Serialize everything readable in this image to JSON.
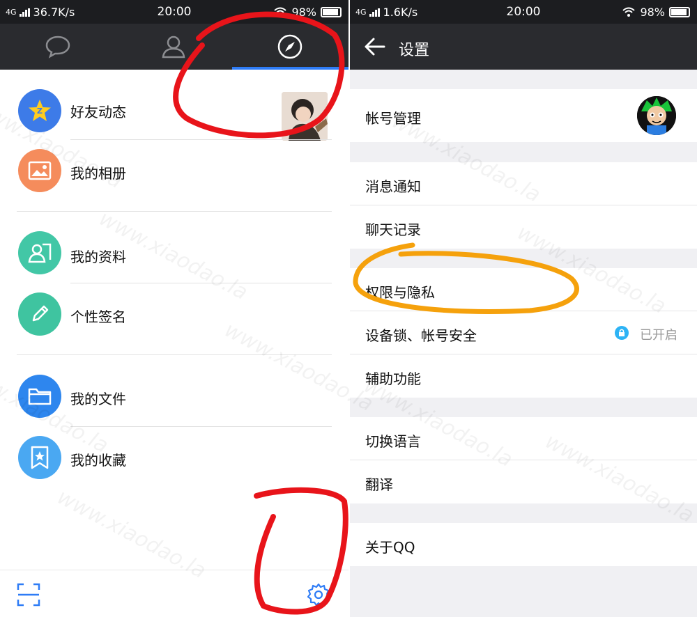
{
  "left": {
    "status": {
      "network": "4G",
      "speed": "36.7K/s",
      "time": "20:00",
      "battery": "98%"
    },
    "tabs": [
      {
        "icon": "chat-bubble-icon"
      },
      {
        "icon": "contacts-icon"
      },
      {
        "icon": "compass-icon",
        "active": true
      }
    ],
    "menu": [
      {
        "label": "好友动态",
        "icon": "qzone-star-icon",
        "color": "#3d7be8"
      },
      {
        "label": "我的相册",
        "icon": "photo-album-icon",
        "color": "#f58c5c"
      },
      {
        "label": "我的资料",
        "icon": "profile-card-icon",
        "color": "#42c7a6"
      },
      {
        "label": "个性签名",
        "icon": "pencil-icon",
        "color": "#3fc4a0"
      },
      {
        "label": "我的文件",
        "icon": "folder-icon",
        "color": "#2e86ee"
      },
      {
        "label": "我的收藏",
        "icon": "bookmark-star-icon",
        "color": "#4aa8f2"
      }
    ],
    "bottom": {
      "scan_icon": "scan-icon",
      "settings_icon": "gear-icon"
    }
  },
  "right": {
    "status": {
      "network": "4G",
      "speed": "1.6K/s",
      "time": "20:00",
      "battery": "98%"
    },
    "title": "设置",
    "items": [
      {
        "label": "帐号管理"
      },
      {
        "label": "消息通知"
      },
      {
        "label": "聊天记录"
      },
      {
        "label": "权限与隐私"
      },
      {
        "label": "设备锁、帐号安全",
        "status": "已开启"
      },
      {
        "label": "辅助功能"
      },
      {
        "label": "切换语言"
      },
      {
        "label": "翻译"
      },
      {
        "label": "关于QQ"
      }
    ]
  },
  "watermark": "www.xiaodao.la",
  "colors": {
    "accent": "#2e7cf6",
    "annotation_red": "#e8141a",
    "annotation_orange": "#f5a10c"
  }
}
